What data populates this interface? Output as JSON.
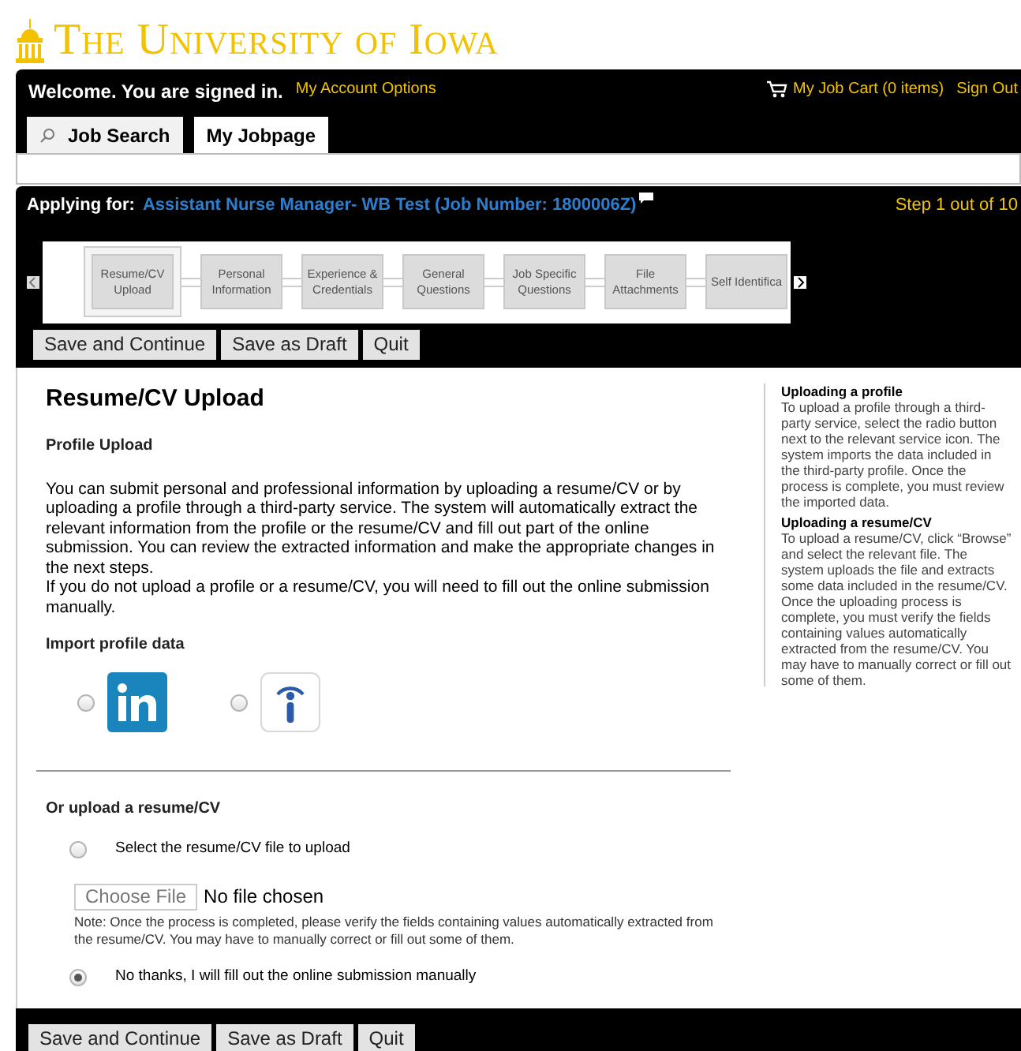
{
  "logo": {
    "text": "The University of Iowa"
  },
  "header": {
    "welcome": "Welcome. You are signed in.",
    "account_link": "My Account Options",
    "cart": "My Job Cart (0 items)",
    "sign_out": "Sign Out"
  },
  "tabs": [
    {
      "label": "Job Search",
      "selected": false,
      "kind": "search"
    },
    {
      "label": "My Jobpage",
      "selected": true,
      "kind": "plain"
    }
  ],
  "application": {
    "applying_label": "Applying for:",
    "job_title": "Assistant Nurse Manager- WB Test (Job Number: 1800006Z)",
    "step_text": "Step 1 out of 10"
  },
  "steps": [
    {
      "label": "Resume/CV Upload",
      "selected": true
    },
    {
      "label": "Personal Information",
      "selected": false
    },
    {
      "label": "Experience & Credentials",
      "selected": false
    },
    {
      "label": "General Questions",
      "selected": false
    },
    {
      "label": "Job Specific Questions",
      "selected": false
    },
    {
      "label": "File Attachments",
      "selected": false
    },
    {
      "label": "Self Identifica",
      "selected": false
    }
  ],
  "top_buttons": [
    "Save and Continue",
    "Save as Draft",
    "Quit"
  ],
  "main": {
    "title": "Resume/CV Upload",
    "subtitle": "Profile Upload",
    "paragraphs": [
      "You can submit personal and professional information by uploading a resume/CV or by uploading a profile through a third-party service. The system will automatically extract the relevant information from the profile or the resume/CV and fill out part of the online submission. You can review the extracted information and make the appropriate changes in the next steps.",
      "If you do not upload a profile or a resume/CV, you will need to fill out the online submission manually."
    ],
    "import_heading": "Import profile data",
    "profile_sources": [
      {
        "kind": "linkedin",
        "selected": false
      },
      {
        "kind": "info",
        "selected": false
      }
    ],
    "upload_heading": "Or upload a resume/CV",
    "upload_options": [
      {
        "kind": "file",
        "label": "Select the resume/CV file to upload",
        "selected": false,
        "file_button": "Choose File",
        "file_status": "No file chosen",
        "note": "Note: Once the process is completed, please verify the fields containing values automatically extracted from the resume/CV. You may have to manually correct or fill out some of them."
      },
      {
        "kind": "manual",
        "label": "No thanks, I will fill out the online submission manually",
        "selected": true
      }
    ]
  },
  "help": [
    {
      "heading": "Uploading a profile",
      "text": "To upload a profile through a third-party service, select the radio button next to the relevant service icon. The system imports the data included in the third-party profile. Once the process is complete, you must review the imported data."
    },
    {
      "heading": "Uploading a resume/CV",
      "text": "To upload a resume/CV, click “Browse” and select the relevant file. The system uploads the file and extracts some data included in the resume/CV. Once the uploading process is complete, you must verify the fields containing values automatically extracted from the resume/CV. You may have to manually correct or fill out some of them."
    }
  ],
  "bottom_buttons": [
    "Save and Continue",
    "Save as Draft",
    "Quit"
  ]
}
